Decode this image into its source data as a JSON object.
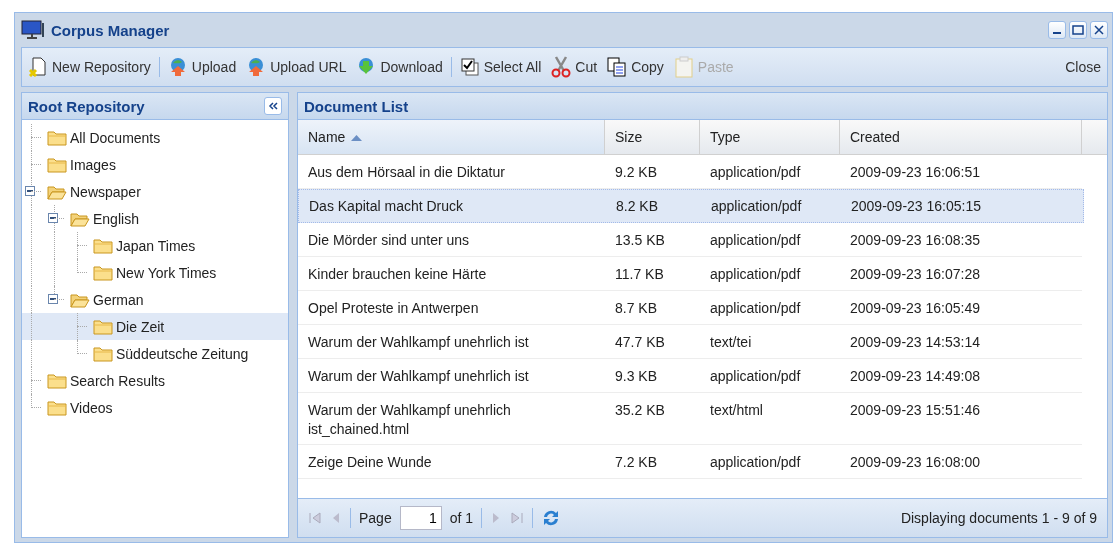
{
  "window": {
    "title": "Corpus Manager"
  },
  "toolbar": [
    {
      "kind": "button",
      "label": "New Repository",
      "disabled": false
    },
    {
      "kind": "separator"
    },
    {
      "kind": "button",
      "label": "Upload",
      "disabled": false
    },
    {
      "kind": "button",
      "label": "Upload URL",
      "disabled": false
    },
    {
      "kind": "button",
      "label": "Download",
      "disabled": false
    },
    {
      "kind": "separator"
    },
    {
      "kind": "button",
      "label": "Select All",
      "disabled": false
    },
    {
      "kind": "button",
      "label": "Cut",
      "disabled": false
    },
    {
      "kind": "button",
      "label": "Copy",
      "disabled": false
    },
    {
      "kind": "button",
      "label": "Paste",
      "disabled": true
    },
    {
      "kind": "spacer"
    },
    {
      "kind": "button",
      "label": "Close",
      "disabled": false
    }
  ],
  "sidebar": {
    "title": "Root Repository",
    "tree": [
      {
        "label": "All Documents",
        "selected": false
      },
      {
        "label": "Images",
        "selected": false
      },
      {
        "label": "Newspaper",
        "selected": false,
        "expanded": true,
        "children": [
          {
            "label": "English",
            "selected": false,
            "expanded": true,
            "children": [
              {
                "label": "Japan Times",
                "selected": false
              },
              {
                "label": "New York Times",
                "selected": false
              }
            ]
          },
          {
            "label": "German",
            "selected": false,
            "expanded": true,
            "children": [
              {
                "label": "Die Zeit",
                "selected": true
              },
              {
                "label": "Süddeutsche Zeitung",
                "selected": false
              }
            ]
          }
        ]
      },
      {
        "label": "Search Results",
        "selected": false
      },
      {
        "label": "Videos",
        "selected": false
      }
    ]
  },
  "table": {
    "title": "Document List",
    "columns": [
      {
        "label": "Name",
        "sorted": true
      },
      {
        "label": "Size",
        "sorted": false
      },
      {
        "label": "Type",
        "sorted": false
      },
      {
        "label": "Created",
        "sorted": false
      }
    ],
    "rows": [
      {
        "selected": false,
        "cells": [
          "Aus dem Hörsaal in die Diktatur",
          "9.2 KB",
          "application/pdf",
          "2009-09-23 16:06:51"
        ]
      },
      {
        "selected": true,
        "cells": [
          "Das Kapital macht Druck",
          "8.2 KB",
          "application/pdf",
          "2009-09-23 16:05:15"
        ]
      },
      {
        "selected": false,
        "cells": [
          "Die Mörder sind unter uns",
          "13.5 KB",
          "application/pdf",
          "2009-09-23 16:08:35"
        ]
      },
      {
        "selected": false,
        "cells": [
          "Kinder brauchen keine Härte",
          "11.7 KB",
          "application/pdf",
          "2009-09-23 16:07:28"
        ]
      },
      {
        "selected": false,
        "cells": [
          "Opel Proteste in Antwerpen",
          "8.7 KB",
          "application/pdf",
          "2009-09-23 16:05:49"
        ]
      },
      {
        "selected": false,
        "cells": [
          "Warum der Wahlkampf unehrlich ist",
          "47.7 KB",
          "text/tei",
          "2009-09-23 14:53:14"
        ]
      },
      {
        "selected": false,
        "cells": [
          "Warum der Wahlkampf unehrlich ist",
          "9.3 KB",
          "application/pdf",
          "2009-09-23 14:49:08"
        ]
      },
      {
        "selected": false,
        "cells": [
          "Warum der Wahlkampf unehrlich ist_chained.html",
          "35.2 KB",
          "text/html",
          "2009-09-23 15:51:46"
        ]
      },
      {
        "selected": false,
        "cells": [
          "Zeige Deine Wunde",
          "7.2 KB",
          "application/pdf",
          "2009-09-23 16:08:00"
        ]
      }
    ]
  },
  "pager": {
    "page_label": "Page",
    "page": "1",
    "of_label": "of 1",
    "status": "Displaying documents 1 - 9 of 9"
  }
}
